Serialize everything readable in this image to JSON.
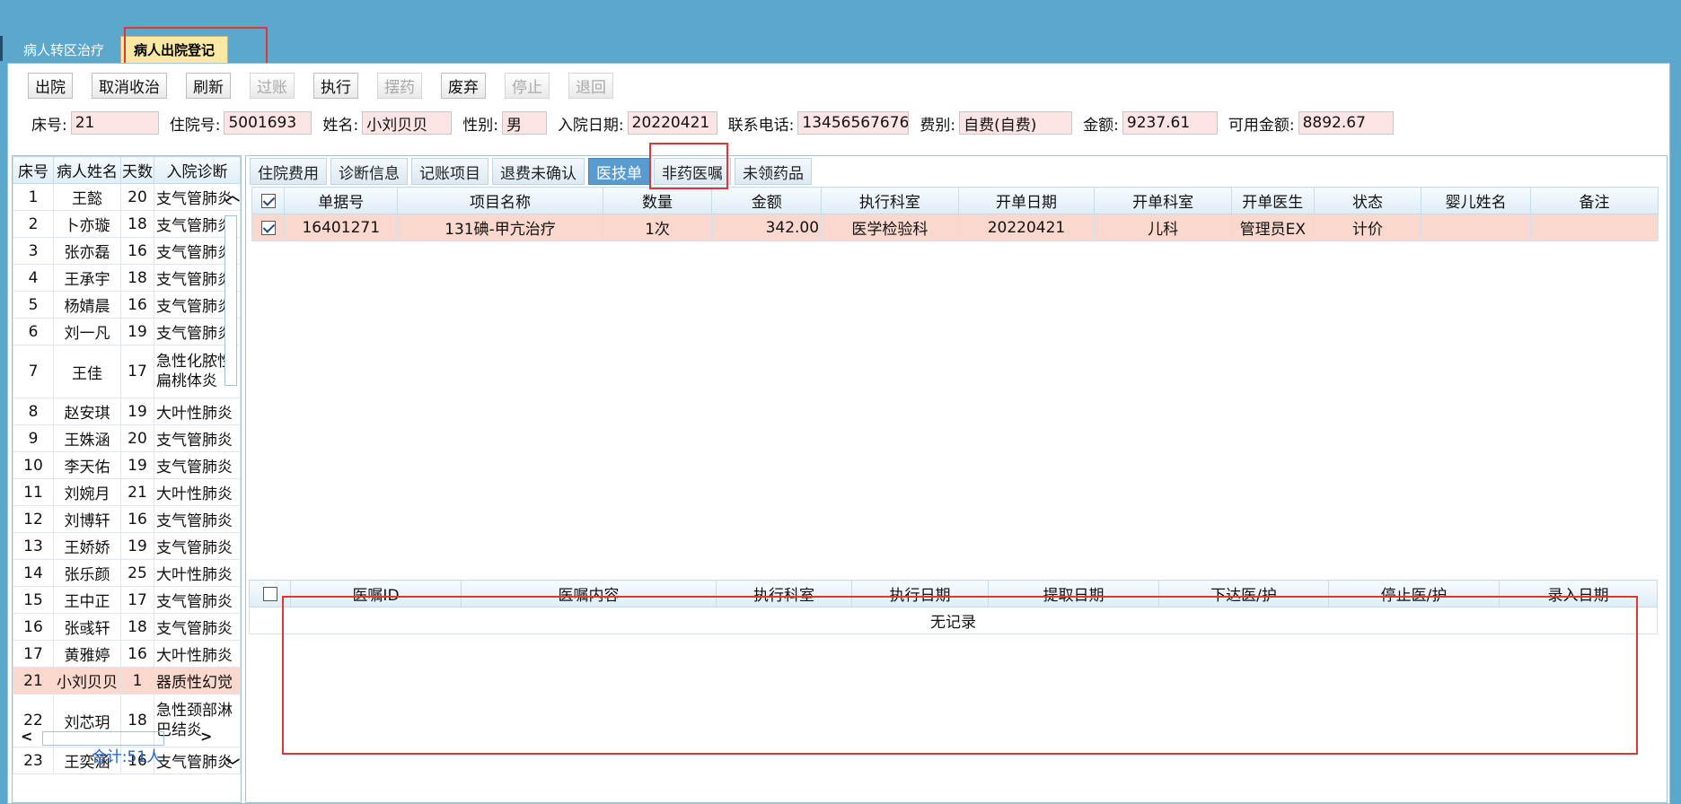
{
  "outer_tabs": [
    {
      "label": "病人转区治疗",
      "active": false
    },
    {
      "label": "病人出院登记",
      "active": true
    }
  ],
  "toolbar": [
    {
      "label": "出院",
      "enabled": true
    },
    {
      "label": "取消收治",
      "enabled": true
    },
    {
      "label": "刷新",
      "enabled": true
    },
    {
      "label": "过账",
      "enabled": false
    },
    {
      "label": "执行",
      "enabled": true
    },
    {
      "label": "摆药",
      "enabled": false
    },
    {
      "label": "废弃",
      "enabled": true
    },
    {
      "label": "停止",
      "enabled": false
    },
    {
      "label": "退回",
      "enabled": false
    }
  ],
  "info": {
    "bed_label": "床号:",
    "bed": "21",
    "inpatient_no_label": "住院号:",
    "inpatient_no": "5001693",
    "name_label": "姓名:",
    "name": "小刘贝贝",
    "gender_label": "性别:",
    "gender": "男",
    "admit_date_label": "入院日期:",
    "admit_date": "20220421",
    "phone_label": "联系电话:",
    "phone": "13456567676",
    "fee_type_label": "费别:",
    "fee_type": "自费(自费)",
    "amount_label": "金额:",
    "amount": "9237.61",
    "available_label": "可用金额:",
    "available": "8892.67"
  },
  "patient_list": {
    "headers": [
      "床号",
      "病人姓名",
      "天数",
      "入院诊断"
    ],
    "rows": [
      {
        "bed": "1",
        "name": "王懿",
        "days": "20",
        "diag": "支气管肺炎"
      },
      {
        "bed": "2",
        "name": "卜亦璇",
        "days": "18",
        "diag": "支气管肺炎"
      },
      {
        "bed": "3",
        "name": "张亦磊",
        "days": "16",
        "diag": "支气管肺炎"
      },
      {
        "bed": "4",
        "name": "王承宇",
        "days": "18",
        "diag": "支气管肺炎"
      },
      {
        "bed": "5",
        "name": "杨婧晨",
        "days": "16",
        "diag": "支气管肺炎"
      },
      {
        "bed": "6",
        "name": "刘一凡",
        "days": "19",
        "diag": "支气管肺炎"
      },
      {
        "bed": "7",
        "name": "王佳",
        "days": "17",
        "diag": "急性化脓性扁桃体炎"
      },
      {
        "bed": "8",
        "name": "赵安琪",
        "days": "19",
        "diag": "大叶性肺炎"
      },
      {
        "bed": "9",
        "name": "王姝涵",
        "days": "20",
        "diag": "支气管肺炎"
      },
      {
        "bed": "10",
        "name": "李天佑",
        "days": "19",
        "diag": "支气管肺炎"
      },
      {
        "bed": "11",
        "name": "刘婉月",
        "days": "21",
        "diag": "大叶性肺炎"
      },
      {
        "bed": "12",
        "name": "刘博轩",
        "days": "16",
        "diag": "支气管肺炎"
      },
      {
        "bed": "13",
        "name": "王娇娇",
        "days": "19",
        "diag": "支气管肺炎"
      },
      {
        "bed": "14",
        "name": "张乐颜",
        "days": "25",
        "diag": "大叶性肺炎"
      },
      {
        "bed": "15",
        "name": "王中正",
        "days": "17",
        "diag": "支气管肺炎"
      },
      {
        "bed": "16",
        "name": "张彧轩",
        "days": "18",
        "diag": "支气管肺炎"
      },
      {
        "bed": "17",
        "name": "黄雅婷",
        "days": "16",
        "diag": "大叶性肺炎"
      },
      {
        "bed": "21",
        "name": "小刘贝贝",
        "days": "1",
        "diag": "器质性幻觉"
      },
      {
        "bed": "22",
        "name": "刘芯玥",
        "days": "18",
        "diag": "急性颈部淋巴结炎"
      },
      {
        "bed": "23",
        "name": "王奕涵",
        "days": "16",
        "diag": "支气管肺炎"
      }
    ],
    "total": "合计:51人"
  },
  "sub_tabs": [
    {
      "label": "住院费用",
      "active": false
    },
    {
      "label": "诊断信息",
      "active": false
    },
    {
      "label": "记账项目",
      "active": false
    },
    {
      "label": "退费未确认",
      "active": false
    },
    {
      "label": "医技单",
      "active": true
    },
    {
      "label": "非药医嘱",
      "active": false
    },
    {
      "label": "未领药品",
      "active": false
    }
  ],
  "tech_grid": {
    "headers": [
      "单据号",
      "项目名称",
      "数量",
      "金额",
      "执行科室",
      "开单日期",
      "开单科室",
      "开单医生",
      "状态",
      "婴儿姓名",
      "备注"
    ],
    "rows": [
      {
        "doc_no": "16401271",
        "item": "131碘-甲亢治疗",
        "qty": "1次",
        "amount": "342.00",
        "exec_dept": "医学检验科",
        "date": "20220421",
        "order_dept": "儿科",
        "doctor": "管理员EX",
        "status": "计价",
        "baby": "",
        "note": ""
      }
    ]
  },
  "order_grid": {
    "headers": [
      "医嘱ID",
      "医嘱内容",
      "执行科室",
      "执行日期",
      "提取日期",
      "下达医/护",
      "停止医/护",
      "录入日期"
    ],
    "empty_text": "无记录"
  }
}
